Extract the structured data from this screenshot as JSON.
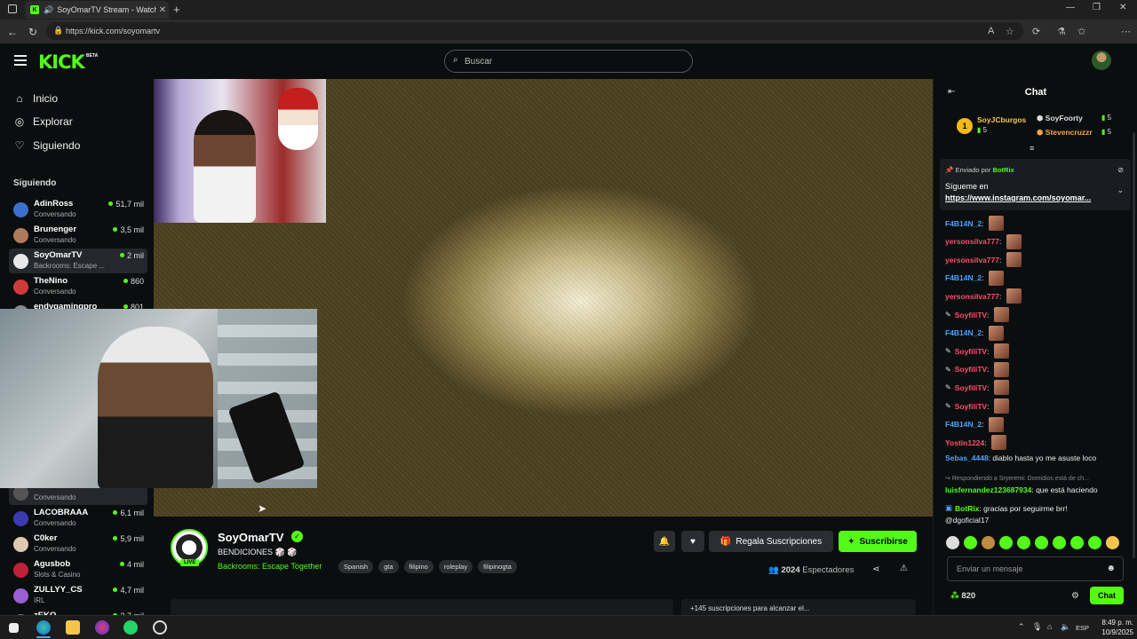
{
  "browser": {
    "tab_title": "SoyOmarTV Stream - Watch",
    "url": "https://kick.com/soyomartv"
  },
  "header": {
    "logo": "KICK",
    "beta": "BETA",
    "search_placeholder": "Buscar"
  },
  "sidebar": {
    "nav": [
      {
        "label": "Inicio",
        "icon": "home-icon"
      },
      {
        "label": "Explorar",
        "icon": "compass-icon"
      },
      {
        "label": "Siguiendo",
        "icon": "heart-icon"
      }
    ],
    "section_title": "Siguiendo",
    "channels_top": [
      {
        "name": "AdinRoss",
        "category": "Conversando",
        "viewers": "51,7 mil",
        "color": "#3b6fd0"
      },
      {
        "name": "Brunenger",
        "category": "Conversando",
        "viewers": "3,5 mil",
        "color": "#b07a5a"
      },
      {
        "name": "SoyOmarTV",
        "category": "Backrooms: Escape ...",
        "viewers": "2 mil",
        "color": "#e8e8e8"
      },
      {
        "name": "TheNino",
        "category": "Conversando",
        "viewers": "860",
        "color": "#d03b3b"
      },
      {
        "name": "endygamingpro",
        "category": "",
        "viewers": "801",
        "color": "#888888"
      }
    ],
    "channels_bottom": [
      {
        "name": "",
        "category": "Conversando",
        "viewers": "",
        "color": "#555555"
      },
      {
        "name": "LACOBRAAA",
        "category": "Conversando",
        "viewers": "6,1 mil",
        "color": "#3b3bb0"
      },
      {
        "name": "C0ker",
        "category": "Conversando",
        "viewers": "5,9 mil",
        "color": "#e0c9b0"
      },
      {
        "name": "Agusbob",
        "category": "Slots & Casino",
        "viewers": "4 mil",
        "color": "#c0203a"
      },
      {
        "name": "ZULLYY_CS",
        "category": "IRL",
        "viewers": "4,7 mil",
        "color": "#9a5fd0"
      },
      {
        "name": "zEKO",
        "category": "",
        "viewers": "3,7 mil",
        "color": "#707070"
      }
    ]
  },
  "stream": {
    "channel_name": "SoyOmarTV",
    "live": "LIVE",
    "title": "BENDICIONES 🎲 🎲",
    "category": "Backrooms: Escape Together",
    "tags": [
      "Spanish",
      "gta",
      "filipino",
      "roleplay",
      "filipinogta"
    ],
    "gift_label": "Regala Suscripciones",
    "subscribe_label": "Suscribirse",
    "viewer_count": "2024",
    "viewers_label": "Espectadores",
    "below_text": "+145 suscripciones para alcanzar el..."
  },
  "chat": {
    "title": "Chat",
    "leaderboard": [
      {
        "rank": "1",
        "name": "SoyJCburgos",
        "count": "5",
        "color": "#f3c54b"
      },
      {
        "name": "SoyFoorty",
        "count": "5",
        "color": "#dddddd"
      },
      {
        "name": "Stevencruzzr",
        "count": "5",
        "color": "#f3a54b"
      }
    ],
    "pinned": {
      "sent_by": "Enviado por",
      "author": "BotRix",
      "line1": "Sígueme en",
      "line2": "https://www.instagram.com/soyomar..."
    },
    "messages": [
      {
        "user": "F4B14N_2",
        "cls": "u-blue",
        "text": "",
        "emote": true,
        "pen": false
      },
      {
        "user": "yersonsilva777",
        "cls": "u-red",
        "text": "",
        "emote": true,
        "pen": false
      },
      {
        "user": "yersonsilva777",
        "cls": "u-red",
        "text": "",
        "emote": true,
        "pen": false
      },
      {
        "user": "F4B14N_2",
        "cls": "u-blue",
        "text": "",
        "emote": true,
        "pen": false
      },
      {
        "user": "yersonsilva777",
        "cls": "u-red",
        "text": "",
        "emote": true,
        "pen": false
      },
      {
        "user": "SoyfiliTV",
        "cls": "u-red",
        "text": "",
        "emote": true,
        "pen": true
      },
      {
        "user": "F4B14N_2",
        "cls": "u-blue",
        "text": "",
        "emote": true,
        "pen": false
      },
      {
        "user": "SoyfiliTV",
        "cls": "u-red",
        "text": "",
        "emote": true,
        "pen": true
      },
      {
        "user": "SoyfiliTV",
        "cls": "u-red",
        "text": "",
        "emote": true,
        "pen": true
      },
      {
        "user": "SoyfiliTV",
        "cls": "u-red",
        "text": "",
        "emote": true,
        "pen": true
      },
      {
        "user": "SoyfiliTV",
        "cls": "u-red",
        "text": "",
        "emote": true,
        "pen": true
      },
      {
        "user": "F4B14N_2",
        "cls": "u-blue",
        "text": "",
        "emote": true,
        "pen": false
      },
      {
        "user": "Yostin1224",
        "cls": "u-red",
        "text": "",
        "emote": true,
        "pen": false
      },
      {
        "user": "Sebas_4448",
        "cls": "u-blue",
        "text": "diablo hasta yo me asuste loco",
        "emote": false,
        "pen": false
      }
    ],
    "reply_to": "Respondiendo a Sryeremi: Domidios está de ch...",
    "message_luis": {
      "user": "luisfernandez123687934",
      "text": "que está haciendo"
    },
    "message_botrix": {
      "user": "BotRix",
      "text": "gracias por seguirme brr!",
      "text2": "@dgoficial17"
    },
    "input_placeholder": "Enviar un mensaje",
    "points": "820",
    "chat_button": "Chat"
  },
  "taskbar": {
    "time": "8:49 p. m.",
    "date": "10/9/2025",
    "lang": "ESP"
  }
}
